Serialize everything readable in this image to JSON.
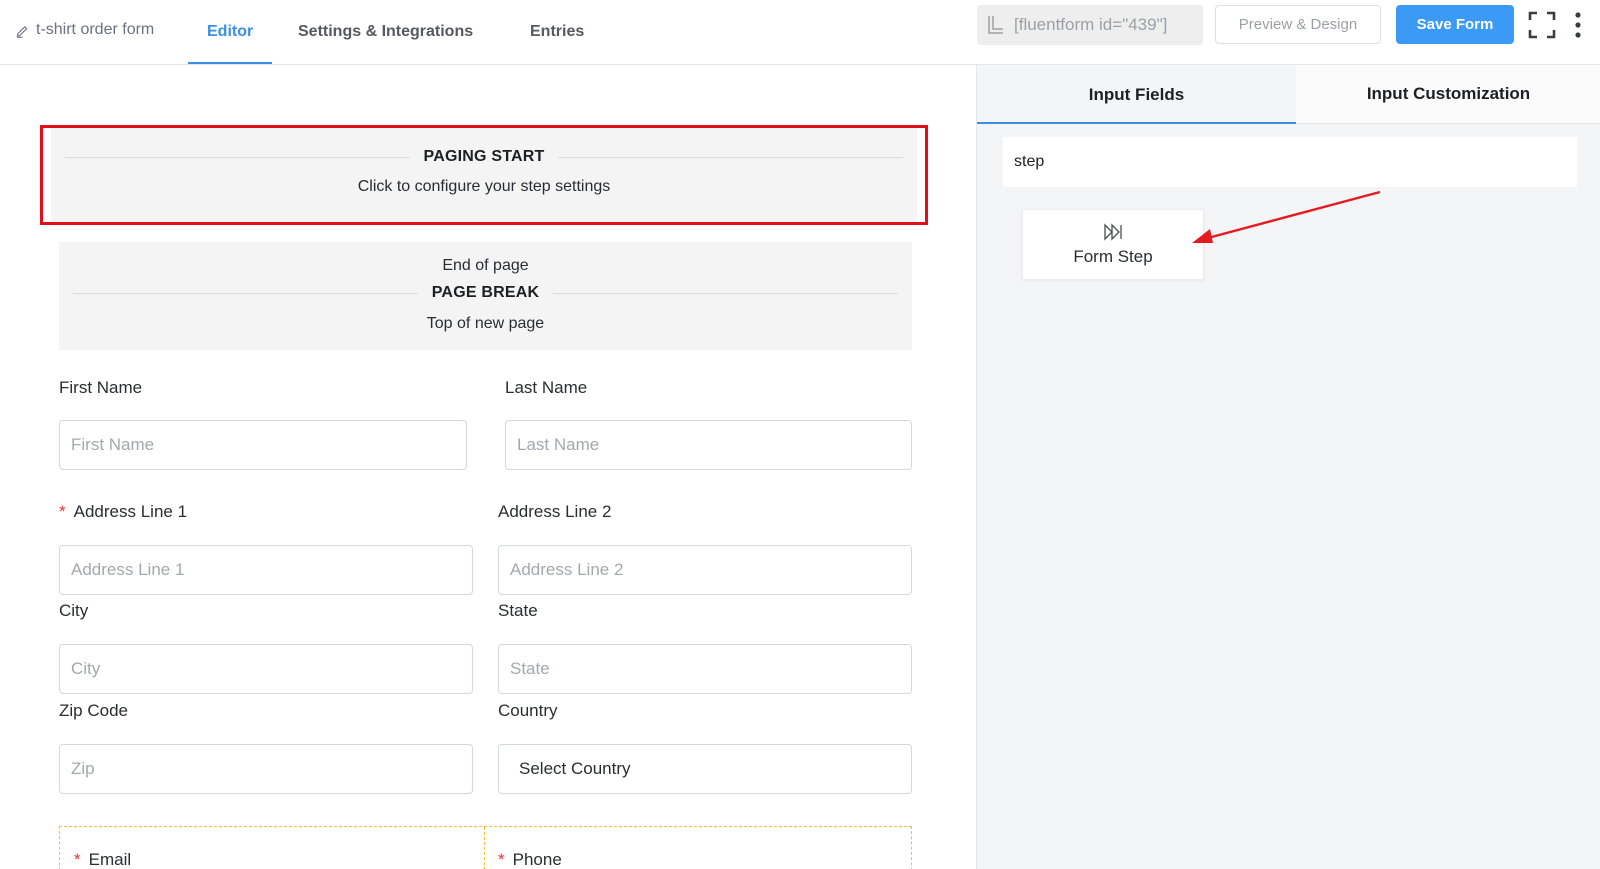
{
  "header": {
    "form_title": "t-shirt order form",
    "tabs": [
      {
        "label": "Editor",
        "active": true
      },
      {
        "label": "Settings & Integrations",
        "active": false
      },
      {
        "label": "Entries",
        "active": false
      }
    ],
    "shortcode": "[fluentform id=\"439\"]",
    "preview_label": "Preview & Design",
    "save_label": "Save Form",
    "icons": [
      "pencil-icon",
      "copy-icon",
      "fullscreen-icon",
      "more-vertical-icon"
    ]
  },
  "editor": {
    "paging_start": {
      "title": "PAGING START",
      "subtitle": "Click to configure your step settings"
    },
    "page_break": {
      "top_text": "End of page",
      "title": "PAGE BREAK",
      "bottom_text": "Top of new page"
    },
    "fields": {
      "first_name": {
        "label": "First Name",
        "placeholder": "First Name"
      },
      "last_name": {
        "label": "Last Name",
        "placeholder": "Last Name"
      },
      "address1": {
        "label": "Address Line 1",
        "placeholder": "Address Line 1",
        "required": true
      },
      "address2": {
        "label": "Address Line 2",
        "placeholder": "Address Line 2"
      },
      "city": {
        "label": "City",
        "placeholder": "City"
      },
      "state": {
        "label": "State",
        "placeholder": "State"
      },
      "zip": {
        "label": "Zip Code",
        "placeholder": "Zip"
      },
      "country": {
        "label": "Country",
        "value": "Select Country"
      },
      "email": {
        "label": "Email",
        "required": true
      },
      "phone": {
        "label": "Phone",
        "required": true
      }
    },
    "required_marker": "*"
  },
  "sidebar": {
    "tabs": [
      {
        "label": "Input Fields",
        "active": true
      },
      {
        "label": "Input Customization",
        "active": false
      }
    ],
    "search_value": "step",
    "result_item": {
      "label": "Form Step",
      "icon": "form-step-icon"
    }
  },
  "colors": {
    "accent": "#3b8fe6",
    "save_button": "#3b9af5",
    "highlight_box": "#e00f18",
    "required": "#e3342f",
    "annotation_arrow": "#e51b20"
  }
}
